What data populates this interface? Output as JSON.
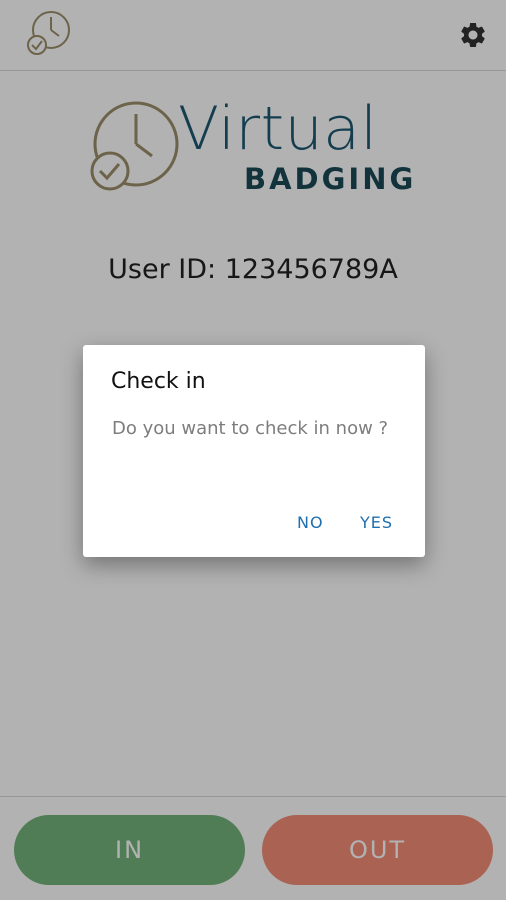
{
  "appbar": {
    "logo_icon": "clock-check-icon",
    "settings_icon": "gear-icon"
  },
  "brand": {
    "title": "Virtual",
    "subtitle": "BADGING",
    "colors": {
      "clock": "#9b8f6a",
      "title": "#1d5a72",
      "subtitle": "#1b4a56"
    }
  },
  "user": {
    "id_text": "User ID: 123456789A"
  },
  "actions": {
    "in_label": "IN",
    "out_label": "OUT",
    "colors": {
      "in": "#74b47b",
      "out": "#f48f78"
    }
  },
  "dialog": {
    "title": "Check in",
    "message": "Do you want to check in now ?",
    "no_label": "NO",
    "yes_label": "YES",
    "button_color": "#1d6fb0"
  }
}
